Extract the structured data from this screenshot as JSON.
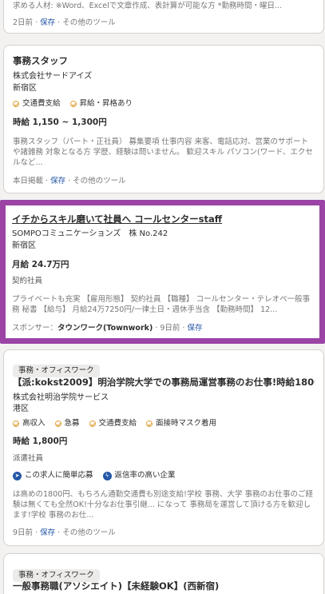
{
  "card0": {
    "desc_tail": "求める人材: ※Word、Excelで文章作成、表計算が可能な方 *勤務時間・曜日...",
    "posted": "2日前",
    "save": "保存",
    "other": "その他のツール"
  },
  "card1": {
    "title": "事務スタッフ",
    "company": "株式会社サードアイズ",
    "location": "新宿区",
    "chips": [
      "交通費支給",
      "昇給・昇格あり"
    ],
    "salary": "時給 1,150 ~ 1,300円",
    "desc": "事務スタッフ（パート・正社員） 募集要項 仕事内容 来客、電話応対、営業のサポートや諸雑務 対象となる方 学歴、経験は問いません。 歓迎スキル パソコン(ワード、エクセルなど...",
    "posted": "本日掲載",
    "save": "保存",
    "other": "その他のツール"
  },
  "card2": {
    "title": "イチからスキル磨いて社員へ コールセンターstaff",
    "company": "SOMPOコミュニケーションズ　株 No.242",
    "location": "新宿区",
    "salary": "月給 24.7万円",
    "employment": "契約社員",
    "desc": "プライベートも充実 【雇用形態】 契約社員 【職種】 コールセンター・テレオペ一般事務 秘書 【給与】 月給24万7250円/一律土日・週休手当含 【勤務時間】 12...",
    "sponsor_label": "スポンサー：",
    "sponsor": "タウンワーク(Townwork)",
    "posted": "9日前",
    "save": "保存"
  },
  "card3": {
    "category": "事務・オフィスワーク",
    "title": "【派:kokst2009】明治学院大学での事務局運営事務のお仕事!時給1800円...",
    "company": "株式会社明治学院サービス",
    "location": "港区",
    "chips": [
      "高収入",
      "急募",
      "交通費支給",
      "面接時マスク着用"
    ],
    "salary": "時給 1,800円",
    "employment": "派遣社員",
    "badges": [
      "この求人に簡単応募",
      "返信率の高い企業"
    ],
    "desc": "は高めの1800円、もちろん通勤交通費も別途支給!学校 事務、大学 事務のお仕事のご経験は無くても全然OK!十分なお仕事引継... になって 事務局を運営して頂ける方を歓迎します!学校 事務のお仕...",
    "posted": "9日前",
    "save": "保存",
    "other": "その他のツール"
  },
  "card4": {
    "category": "事務・オフィスワーク",
    "title": "一般事務職(アソシエイト)【未経験OK】(西新宿)"
  }
}
